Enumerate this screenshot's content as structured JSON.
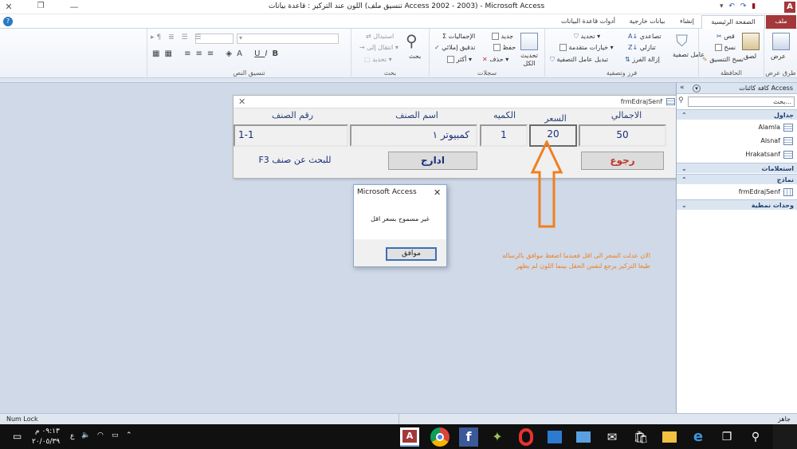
{
  "window": {
    "title": "اللون عند التركيز : قاعدة بيانات (تنسيق ملف Access 2002 - 2003) - Microsoft Access",
    "qat_app_icon": "access-app-icon",
    "qat_items": [
      "save-icon",
      "undo-icon",
      "redo-icon",
      "customize-icon"
    ],
    "controls": [
      "minimize-icon",
      "restore-icon",
      "close-icon"
    ]
  },
  "ribbon": {
    "tabs": [
      {
        "label": "ملف",
        "active": false,
        "file": true
      },
      {
        "label": "الصفحة الرئيسية",
        "active": true
      },
      {
        "label": "إنشاء",
        "active": false
      },
      {
        "label": "بيانات خارجية",
        "active": false
      },
      {
        "label": "أدوات قاعدة البيانات",
        "active": false
      }
    ],
    "groups": {
      "views": {
        "label": "طرق عرض",
        "button": "عرض"
      },
      "clipboard": {
        "label": "الحافظة",
        "paste": "لصق",
        "cut": "قص",
        "copy": "نسخ",
        "format_painter": "نسخ التنسيق"
      },
      "sort_filter": {
        "label": "فرز وتصفية",
        "filter": "عامل تصفية",
        "ascending": "تصاعدي",
        "descending": "تنازلي",
        "remove_sort": "إزالة الفرز",
        "selection": "تحديد",
        "advanced": "خيارات متقدمة",
        "toggle_filter": "تبديل عامل التصفية"
      },
      "records": {
        "label": "سجلات",
        "refresh": "تحديث الكل",
        "new": "جديد",
        "save": "حفظ",
        "delete": "حذف",
        "totals": "الإجماليات",
        "spelling": "تدقيق إملائي",
        "more": "أكثر"
      },
      "find": {
        "label": "بحث",
        "find": "بحث",
        "replace": "استبدال",
        "goto": "انتقال إلى",
        "select": "تحديد"
      },
      "text_format": {
        "label": "تنسيق النص"
      }
    }
  },
  "nav_pane": {
    "title": "كافة كائنات Access",
    "search_placeholder": "بحث...",
    "sections": [
      {
        "label": "جداول",
        "items": [
          "Alamla",
          "Alsnaf",
          "Hrakatsanf"
        ]
      },
      {
        "label": "استعلامات",
        "items": []
      },
      {
        "label": "نماذج",
        "items": [
          "frmEdrajSenf"
        ]
      },
      {
        "label": "وحدات نمطية",
        "items": []
      }
    ]
  },
  "form": {
    "caption": "frmEdrajSenf",
    "labels": {
      "total": "الاجمالي",
      "price": "السعر",
      "qty": "الكميه",
      "name": "اسم الصنف",
      "code": "رقم الصنف"
    },
    "values": {
      "total": "50",
      "price": "20",
      "qty": "1",
      "name": "كمبيوتر ١",
      "code": "1-1"
    },
    "buttons": {
      "back": "رجوع",
      "insert": "ادارج"
    },
    "hint": "للبحث عن صنف F3"
  },
  "msgbox": {
    "title": "Microsoft Access",
    "message": "غير مسموح بسعر اقل",
    "ok": "موافق"
  },
  "annotation": {
    "line1": "الان عدلت السعر الى اقل فعندما اضغط موافق بالرساله",
    "line2": "طبعا التركيز يرجع لنفس الحقل بينما اللون لم يظهر",
    "color": "#f07f1f"
  },
  "status": {
    "left": "Num Lock",
    "right": "جاهز"
  },
  "taskbar": {
    "time": "٠٩:١٣ م",
    "date": "٢٠/٠٥/٣٩",
    "lang": "ع",
    "apps": [
      "access-icon",
      "chrome-icon",
      "facebook-icon",
      "app-icon",
      "opera-icon",
      "photos-icon",
      "mail-icon",
      "store-icon",
      "folder-icon",
      "edge-icon",
      "task-view-icon",
      "search-icon"
    ]
  },
  "colors": {
    "accent": "#c0392b",
    "nav_header": "#1f3f6e",
    "orange": "#f07f1f"
  }
}
